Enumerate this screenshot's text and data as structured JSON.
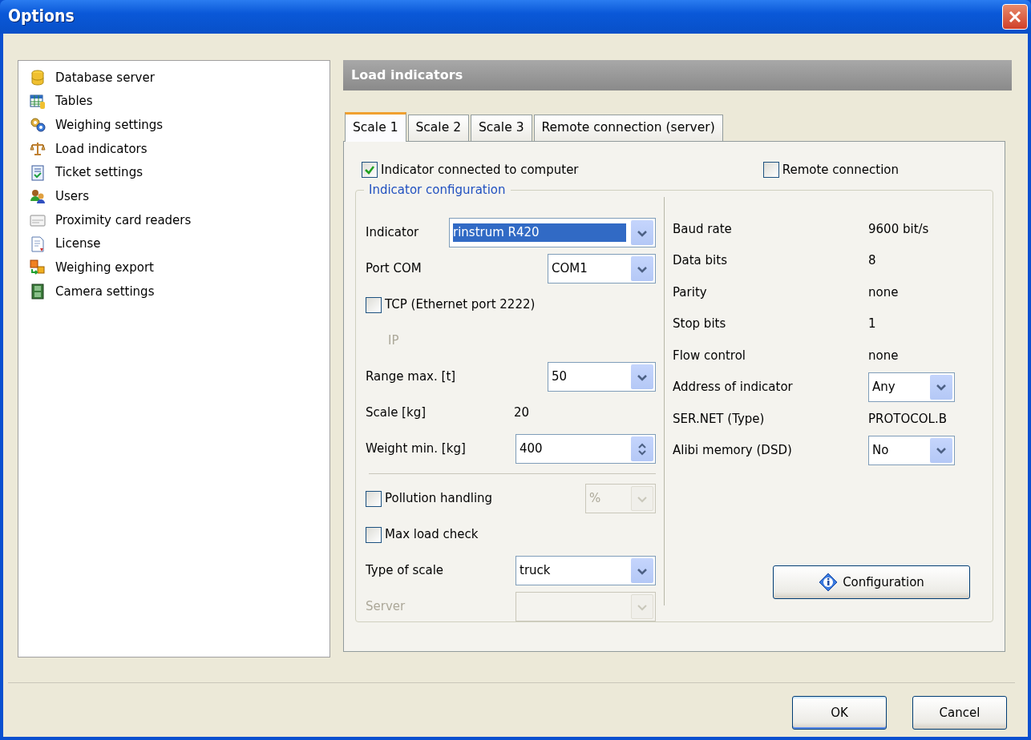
{
  "window": {
    "title": "Options"
  },
  "sidebar": {
    "items": [
      {
        "label": "Database server",
        "selected": false
      },
      {
        "label": "Tables",
        "selected": false
      },
      {
        "label": "Weighing settings",
        "selected": false
      },
      {
        "label": "Load indicators",
        "selected": false
      },
      {
        "label": "Ticket settings",
        "selected": false
      },
      {
        "label": "Users",
        "selected": false
      },
      {
        "label": "Proximity card readers",
        "selected": false
      },
      {
        "label": "License",
        "selected": false
      },
      {
        "label": "Weighing export",
        "selected": false
      },
      {
        "label": "Camera settings",
        "selected": false
      }
    ]
  },
  "panel": {
    "title": "Load indicators",
    "tabs": [
      {
        "label": "Scale 1",
        "selected": true
      },
      {
        "label": "Scale 2",
        "selected": false
      },
      {
        "label": "Scale 3",
        "selected": false
      },
      {
        "label": "Remote connection (server)",
        "selected": false
      }
    ],
    "connected_checkbox": {
      "label": "Indicator connected to computer",
      "checked": true
    },
    "remote_checkbox": {
      "label": "Remote connection",
      "checked": false
    },
    "group": {
      "legend": "Indicator configuration",
      "left_top": [
        {
          "kind": "select",
          "label": "Indicator",
          "value": "rinstrum R420",
          "highlighted": true,
          "disabled": false
        },
        {
          "kind": "select",
          "label": "Port COM",
          "value": "COM1",
          "highlighted": false,
          "disabled": false
        },
        {
          "kind": "checkbox",
          "label": "TCP (Ethernet port 2222)",
          "checked": false
        },
        {
          "kind": "text",
          "label": "IP",
          "disabled": true
        },
        {
          "kind": "select",
          "label": "Range max. [t]",
          "value": "50",
          "highlighted": false,
          "disabled": false
        },
        {
          "kind": "value",
          "label": "Scale [kg]",
          "value": "20"
        },
        {
          "kind": "spin",
          "label": "Weight min. [kg]",
          "value": "400"
        }
      ],
      "left_bottom": [
        {
          "kind": "checkselect",
          "label": "Pollution handling",
          "checked": false,
          "value": "%",
          "disabled": true
        },
        {
          "kind": "checkbox",
          "label": "Max load check",
          "checked": false
        },
        {
          "kind": "select",
          "label": "Type of scale",
          "value": "truck",
          "highlighted": false,
          "disabled": false
        },
        {
          "kind": "select",
          "label": "Server",
          "disabled": true
        }
      ],
      "params": [
        {
          "kind": "value",
          "label": "Baud rate",
          "value": "9600 bit/s"
        },
        {
          "kind": "value",
          "label": "Data bits",
          "value": "8"
        },
        {
          "kind": "value",
          "label": "Parity",
          "value": "none"
        },
        {
          "kind": "value",
          "label": "Stop bits",
          "value": "1"
        },
        {
          "kind": "value",
          "label": "Flow control",
          "value": "none"
        },
        {
          "kind": "select",
          "label": "Address of indicator",
          "value": "Any"
        },
        {
          "kind": "value",
          "label": "SER.NET (Type)",
          "value": "PROTOCOL.B"
        },
        {
          "kind": "select",
          "label": "Alibi memory (DSD)",
          "value": "No"
        }
      ],
      "config_button": "Configuration"
    }
  },
  "buttons": [
    {
      "label": "OK",
      "default": true
    },
    {
      "label": "Cancel",
      "default": false
    }
  ]
}
